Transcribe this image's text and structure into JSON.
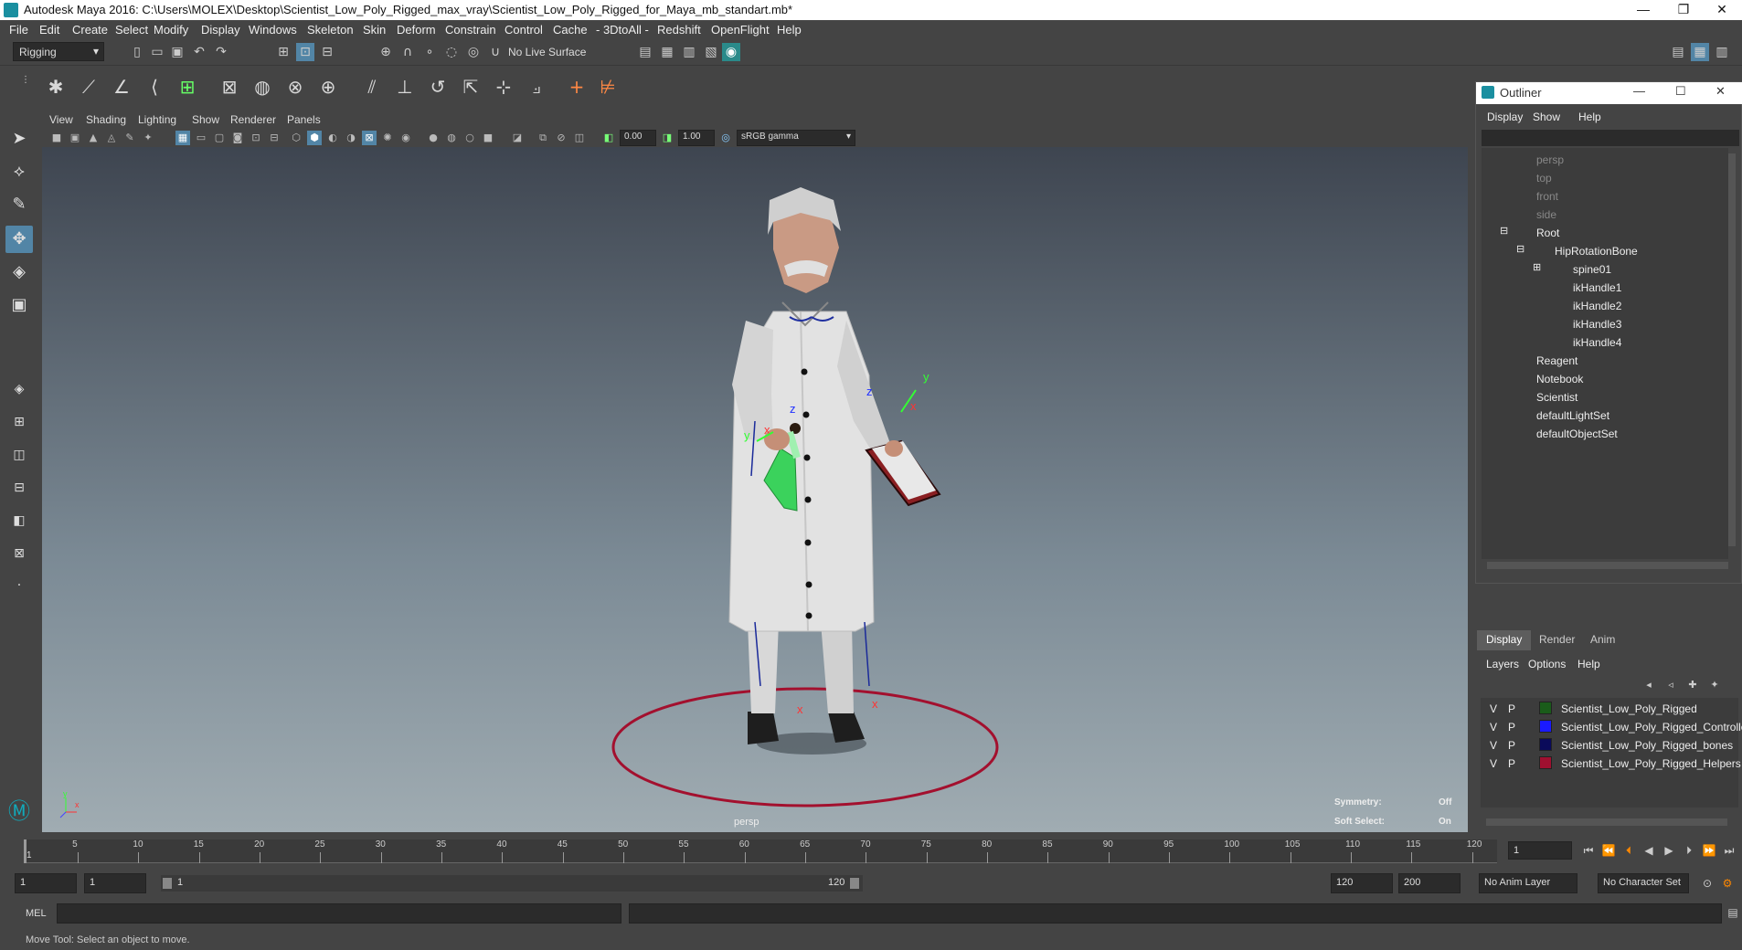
{
  "window": {
    "title": "Autodesk Maya 2016: C:\\Users\\MOLEX\\Desktop\\Scientist_Low_Poly_Rigged_max_vray\\Scientist_Low_Poly_Rigged_for_Maya_mb_standart.mb*"
  },
  "menu": [
    "File",
    "Edit",
    "Create",
    "Select",
    "Modify",
    "Display",
    "Windows",
    "Skeleton",
    "Skin",
    "Deform",
    "Constrain",
    "Control",
    "Cache",
    "- 3DtoAll -",
    "Redshift",
    "OpenFlight",
    "Help"
  ],
  "shelf": {
    "mode": "Rigging",
    "live_surface": "No Live Surface"
  },
  "panel_menu": [
    "View",
    "Shading",
    "Lighting",
    "Show",
    "Renderer",
    "Panels"
  ],
  "panel_toolbar": {
    "near": "0.00",
    "far": "1.00",
    "colorspace": "sRGB gamma"
  },
  "viewport": {
    "camera": "persp",
    "symmetry_label": "Symmetry:",
    "symmetry_value": "Off",
    "soft_select_label": "Soft Select:",
    "soft_select_value": "On",
    "axis_x": "x",
    "axis_y": "y",
    "axis_z": "z"
  },
  "outliner": {
    "title": "Outliner",
    "menu": [
      "Display",
      "Show",
      "Help"
    ],
    "items": [
      {
        "label": "persp",
        "dim": true
      },
      {
        "label": "top",
        "dim": true
      },
      {
        "label": "front",
        "dim": true
      },
      {
        "label": "side",
        "dim": true
      },
      {
        "label": "Root",
        "dim": false
      },
      {
        "label": "HipRotationBone",
        "dim": false
      },
      {
        "label": "spine01",
        "dim": false
      },
      {
        "label": "ikHandle1",
        "dim": false
      },
      {
        "label": "ikHandle2",
        "dim": false
      },
      {
        "label": "ikHandle3",
        "dim": false
      },
      {
        "label": "ikHandle4",
        "dim": false
      },
      {
        "label": "Reagent",
        "dim": false
      },
      {
        "label": "Notebook",
        "dim": false
      },
      {
        "label": "Scientist",
        "dim": false
      },
      {
        "label": "defaultLightSet",
        "dim": false
      },
      {
        "label": "defaultObjectSet",
        "dim": false
      }
    ]
  },
  "layer_editor": {
    "tabs": [
      "Display",
      "Render",
      "Anim"
    ],
    "menu": [
      "Layers",
      "Options",
      "Help"
    ],
    "layers": [
      {
        "v": "V",
        "p": "P",
        "name": "Scientist_Low_Poly_Rigged",
        "color": "#1a5c1a"
      },
      {
        "v": "V",
        "p": "P",
        "name": "Scientist_Low_Poly_Rigged_Controllers",
        "color": "#1a1aff"
      },
      {
        "v": "V",
        "p": "P",
        "name": "Scientist_Low_Poly_Rigged_bones",
        "color": "#0a0a5a"
      },
      {
        "v": "V",
        "p": "P",
        "name": "Scientist_Low_Poly_Rigged_Helpers",
        "color": "#a01030"
      }
    ]
  },
  "timeline": {
    "ticks": [
      "5",
      "10",
      "15",
      "20",
      "25",
      "30",
      "35",
      "40",
      "45",
      "50",
      "55",
      "60",
      "65",
      "70",
      "75",
      "80",
      "85",
      "90",
      "95",
      "100",
      "105",
      "110",
      "115",
      "120"
    ],
    "start_marker": "1",
    "current_frame": "1"
  },
  "range": {
    "start": "1",
    "anim_start": "1",
    "slider_start": "1",
    "slider_end": "120",
    "end": "120",
    "anim_end": "200",
    "anim_layer": "No Anim Layer",
    "char_set": "No Character Set"
  },
  "command": {
    "lang": "MEL"
  },
  "help_line": "Move Tool: Select an object to move."
}
